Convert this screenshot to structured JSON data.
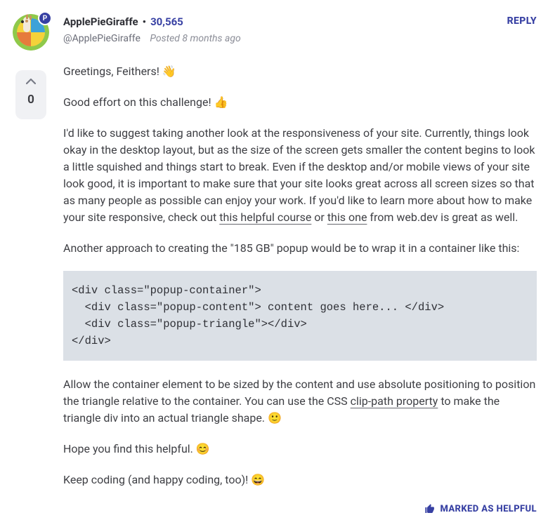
{
  "user": {
    "name": "ApplePieGiraffe",
    "points": "30,565",
    "handle": "@ApplePieGiraffe",
    "posted": "Posted 8 months ago",
    "badge": "P"
  },
  "reply_label": "REPLY",
  "vote": {
    "count": "0"
  },
  "body": {
    "greeting": "Greetings, Feithers! 👋",
    "effort": "Good effort on this challenge! 👍",
    "suggest_pre": "I'd like to suggest taking another look at the responsiveness of your site. Currently, things look okay in the desktop layout, but as the size of the screen gets smaller the content begins to look a little squished and things start to break. Even if the desktop and/or mobile views of your site look good, it is important to make sure that your site looks great across all screen sizes so that as many people as possible can enjoy your work. If you'd like to learn more about how to make your site responsive, check out ",
    "link1": "this helpful course",
    "suggest_mid": " or ",
    "link2": "this one",
    "suggest_post": " from web.dev is great as well.",
    "approach_intro": "Another approach to creating the \"185 GB\" popup would be to wrap it in a container like this:",
    "code": "<div class=\"popup-container\">\n  <div class=\"popup-content\"> content goes here... </div>\n  <div class=\"popup-triangle\"></div>\n</div>",
    "triangle_pre": "Allow the container element to be sized by the content and use absolute positioning to position the triangle relative to the container. You can use the CSS ",
    "link3": "clip-path property",
    "triangle_post": " to make the triangle div into an actual triangle shape. 🙂",
    "helpful": "Hope you find this helpful. 😊",
    "closing": "Keep coding (and happy coding, too)! 😄"
  },
  "marked_helpful": "MARKED AS HELPFUL"
}
